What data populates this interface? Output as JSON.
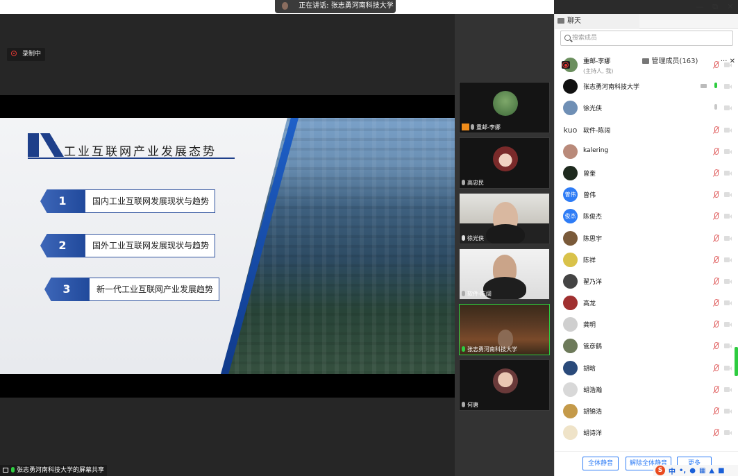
{
  "window": {
    "speaking_label": "正在讲话: 张志勇河南科技大学",
    "controls": {
      "minimize": "—",
      "restore": "⧉",
      "close": "✕"
    }
  },
  "stage": {
    "recording_label": "录制中",
    "share_label": "张志勇河南科技大学的屏幕共享",
    "slide": {
      "title": "工业互联网产业发展态势",
      "items": [
        {
          "num": "1",
          "label": "国内工业互联网发展现状与趋势"
        },
        {
          "num": "2",
          "label": "国外工业互联网发展现状与趋势"
        },
        {
          "num": "3",
          "label": "新一代工业互联网产业发展趋势"
        }
      ]
    }
  },
  "video_tiles": [
    {
      "name": "重邮-李娜",
      "host": true,
      "mic": "muted"
    },
    {
      "name": "高忠民",
      "host": false,
      "mic": "muted"
    },
    {
      "name": "徐光侠",
      "host": false,
      "mic": "normal"
    },
    {
      "name": "软件-陈阔",
      "host": false,
      "mic": "muted"
    },
    {
      "name": "张志勇河南科技大学",
      "host": false,
      "mic": "on"
    },
    {
      "name": "何唐",
      "host": false,
      "mic": "muted"
    }
  ],
  "panel": {
    "tab_chat": "聊天",
    "tab_members": "管理成员(163)",
    "tab_more": "···",
    "tab_close": "✕",
    "search_placeholder": "搜索成员",
    "members": [
      {
        "name": "重邮-李娜",
        "sub": "(主持人, 我)",
        "avatar_color": "#6b8f5e",
        "avatar_text": "",
        "mic": "off",
        "extra": "rec"
      },
      {
        "name": "张志勇河南科技大学",
        "sub": "",
        "avatar_color": "#111111",
        "avatar_text": "",
        "mic": "on",
        "extra": "share"
      },
      {
        "name": "徐光侠",
        "sub": "",
        "avatar_color": "#6f8fb5",
        "avatar_text": "",
        "mic": "grey",
        "extra": ""
      },
      {
        "name": "软件-陈阔",
        "sub": "",
        "avatar_color": "#ffffff",
        "avatar_text": "kuo",
        "mic": "off",
        "extra": ""
      },
      {
        "name": "kalering",
        "sub": "",
        "avatar_color": "#b98a7a",
        "avatar_text": "",
        "mic": "off",
        "extra": ""
      },
      {
        "name": "曾奎",
        "sub": "",
        "avatar_color": "#1e2a1e",
        "avatar_text": "",
        "mic": "off",
        "extra": ""
      },
      {
        "name": "曾伟",
        "sub": "",
        "avatar_color": "#2e7cf6",
        "avatar_text": "曾伟",
        "mic": "off",
        "extra": ""
      },
      {
        "name": "陈俊杰",
        "sub": "",
        "avatar_color": "#2e7cf6",
        "avatar_text": "俊杰",
        "mic": "off",
        "extra": ""
      },
      {
        "name": "陈思宇",
        "sub": "",
        "avatar_color": "#7a5a3a",
        "avatar_text": "",
        "mic": "off",
        "extra": ""
      },
      {
        "name": "陈祥",
        "sub": "",
        "avatar_color": "#d9c24a",
        "avatar_text": "",
        "mic": "off",
        "extra": ""
      },
      {
        "name": "翟乃洋",
        "sub": "",
        "avatar_color": "#444444",
        "avatar_text": "",
        "mic": "off",
        "extra": ""
      },
      {
        "name": "高龙",
        "sub": "",
        "avatar_color": "#a03030",
        "avatar_text": "",
        "mic": "off",
        "extra": ""
      },
      {
        "name": "龚明",
        "sub": "",
        "avatar_color": "#cfcfcf",
        "avatar_text": "",
        "mic": "off",
        "extra": ""
      },
      {
        "name": "管彦鹤",
        "sub": "",
        "avatar_color": "#6d7a5a",
        "avatar_text": "",
        "mic": "off",
        "extra": ""
      },
      {
        "name": "胡晗",
        "sub": "",
        "avatar_color": "#2a4a7a",
        "avatar_text": "",
        "mic": "off",
        "extra": ""
      },
      {
        "name": "胡浩瀚",
        "sub": "",
        "avatar_color": "#d8d8d8",
        "avatar_text": "",
        "mic": "off",
        "extra": ""
      },
      {
        "name": "胡锦浩",
        "sub": "",
        "avatar_color": "#c49a4a",
        "avatar_text": "",
        "mic": "off",
        "extra": ""
      },
      {
        "name": "胡诗洋",
        "sub": "",
        "avatar_color": "#efe3c8",
        "avatar_text": "",
        "mic": "off",
        "extra": ""
      }
    ],
    "footer": {
      "mute_all": "全体静音",
      "unmute_all": "解除全体静音",
      "more": "更多"
    },
    "ime": {
      "logo": "S",
      "lang": "中"
    }
  },
  "colors": {
    "accent": "#2e7cf6",
    "mic_on": "#2ecc40",
    "mic_off": "#e06060",
    "recording": "#e53935",
    "slide_blue": "#1e3f8a"
  }
}
